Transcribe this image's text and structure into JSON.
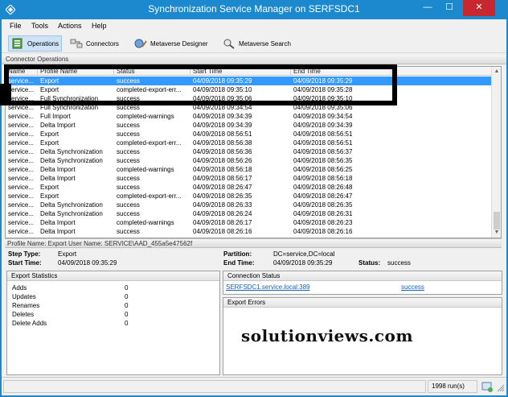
{
  "window": {
    "title": "Synchronization Service Manager on SERFSDC1",
    "minimize": "—",
    "maximize": "☐",
    "close": "✕"
  },
  "menu": [
    "File",
    "Tools",
    "Actions",
    "Help"
  ],
  "toolbar": {
    "operations": "Operations",
    "connectors": "Connectors",
    "metaverse_designer": "Metaverse Designer",
    "metaverse_search": "Metaverse Search"
  },
  "connector_operations": {
    "header": "Connector Operations",
    "columns": [
      "Name",
      "Profile Name",
      "Status",
      "Start Time",
      "End Time"
    ],
    "rows": [
      [
        "service...",
        "Export",
        "success",
        "04/09/2018 09:35:29",
        "04/09/2018 09:35:29"
      ],
      [
        "service...",
        "Export",
        "completed-export-err...",
        "04/09/2018 09:35:10",
        "04/09/2018 09:35:28"
      ],
      [
        "service...",
        "Full Synchronization",
        "success",
        "04/09/2018 09:35:06",
        "04/09/2018 09:35:10"
      ],
      [
        "service...",
        "Full Synchronization",
        "success",
        "04/09/2018 09:34:54",
        "04/09/2018 09:35:06"
      ],
      [
        "service...",
        "Full Import",
        "completed-warnings",
        "04/09/2018 09:34:39",
        "04/09/2018 09:34:54"
      ],
      [
        "service...",
        "Delta Import",
        "success",
        "04/09/2018 09:34:39",
        "04/09/2018 09:34:39"
      ],
      [
        "service...",
        "Export",
        "success",
        "04/09/2018 08:56:51",
        "04/09/2018 08:56:51"
      ],
      [
        "service...",
        "Export",
        "completed-export-err...",
        "04/09/2018 08:56:38",
        "04/09/2018 08:56:51"
      ],
      [
        "service...",
        "Delta Synchronization",
        "success",
        "04/09/2018 08:56:36",
        "04/09/2018 08:56:37"
      ],
      [
        "service...",
        "Delta Synchronization",
        "success",
        "04/09/2018 08:56:26",
        "04/09/2018 08:56:35"
      ],
      [
        "service...",
        "Delta Import",
        "completed-warnings",
        "04/09/2018 08:56:18",
        "04/09/2018 08:56:25"
      ],
      [
        "service...",
        "Delta Import",
        "success",
        "04/09/2018 08:56:17",
        "04/09/2018 08:56:18"
      ],
      [
        "service...",
        "Export",
        "success",
        "04/09/2018 08:26:47",
        "04/09/2018 08:26:48"
      ],
      [
        "service...",
        "Export",
        "completed-export-err...",
        "04/09/2018 08:26:35",
        "04/09/2018 08:26:47"
      ],
      [
        "service...",
        "Delta Synchronization",
        "success",
        "04/09/2018 08:26:33",
        "04/09/2018 08:26:35"
      ],
      [
        "service...",
        "Delta Synchronization",
        "success",
        "04/09/2018 08:26:24",
        "04/09/2018 08:26:31"
      ],
      [
        "service...",
        "Delta Import",
        "completed-warnings",
        "04/09/2018 08:26:17",
        "04/09/2018 08:26:23"
      ],
      [
        "service...",
        "Delta Import",
        "success",
        "04/09/2018 08:26:16",
        "04/09/2018 08:26:16"
      ]
    ]
  },
  "profile": {
    "bar": "Profile Name: Export  User Name: SERVICE\\AAD_455a5e47562f",
    "step_type_label": "Step Type:",
    "step_type": "Export",
    "start_time_label": "Start Time:",
    "start_time": "04/09/2018 09:35:29",
    "partition_label": "Partition:",
    "partition": "DC=service,DC=local",
    "end_time_label": "End Time:",
    "end_time": "04/09/2018 09:35:29",
    "status_label": "Status:",
    "status": "success"
  },
  "export_statistics": {
    "header": "Export Statistics",
    "rows": [
      {
        "label": "Adds",
        "value": "0"
      },
      {
        "label": "Updates",
        "value": "0"
      },
      {
        "label": "Renames",
        "value": "0"
      },
      {
        "label": "Deletes",
        "value": "0"
      },
      {
        "label": "Delete Adds",
        "value": "0"
      }
    ]
  },
  "connection_status": {
    "header": "Connection Status",
    "server": "SERFSDC1.service.local:389",
    "result": "success"
  },
  "export_errors": {
    "header": "Export Errors"
  },
  "watermark": "solutionviews.com",
  "statusbar": {
    "runs": "1998 run(s)"
  }
}
